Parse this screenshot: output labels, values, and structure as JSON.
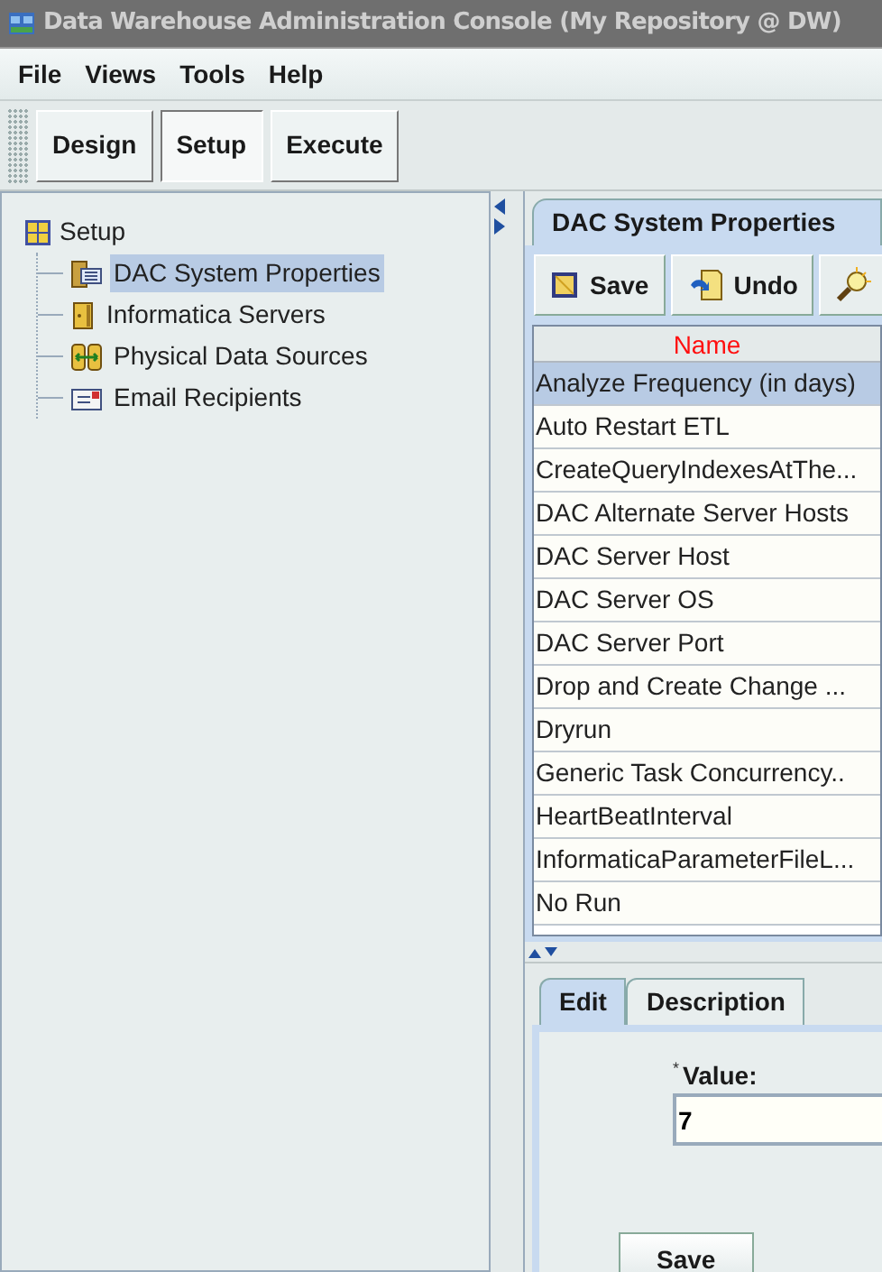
{
  "window": {
    "title": "Data Warehouse Administration Console (My Repository @ DW)"
  },
  "menu": [
    "File",
    "Views",
    "Tools",
    "Help"
  ],
  "views": [
    {
      "label": "Design",
      "selected": false
    },
    {
      "label": "Setup",
      "selected": true
    },
    {
      "label": "Execute",
      "selected": false
    }
  ],
  "tree": {
    "label": "Setup",
    "children": [
      {
        "label": "DAC System Properties",
        "kind": "properties",
        "selected": true
      },
      {
        "label": "Informatica Servers",
        "kind": "server",
        "selected": false
      },
      {
        "label": "Physical Data Sources",
        "kind": "sources",
        "selected": false
      },
      {
        "label": "Email Recipients",
        "kind": "email",
        "selected": false
      }
    ]
  },
  "panel": {
    "title": "DAC System Properties",
    "toolbar": [
      {
        "label": "Save",
        "kind": "save"
      },
      {
        "label": "Undo",
        "kind": "undo"
      },
      {
        "kind": "query"
      }
    ],
    "table": {
      "columns": [
        "Name"
      ],
      "rows": [
        {
          "name": "Analyze Frequency (in days)",
          "selected": true
        },
        {
          "name": "Auto Restart ETL",
          "selected": false
        },
        {
          "name": "CreateQueryIndexesAtThe...",
          "selected": false
        },
        {
          "name": "DAC Alternate Server Hosts",
          "selected": false
        },
        {
          "name": "DAC Server Host",
          "selected": false
        },
        {
          "name": "DAC Server OS",
          "selected": false
        },
        {
          "name": "DAC Server Port",
          "selected": false
        },
        {
          "name": "Drop and Create Change ...",
          "selected": false
        },
        {
          "name": "Dryrun",
          "selected": false
        },
        {
          "name": "Generic Task Concurrency..",
          "selected": false
        },
        {
          "name": "HeartBeatInterval",
          "selected": false
        },
        {
          "name": "InformaticaParameterFileL...",
          "selected": false
        },
        {
          "name": "No Run",
          "selected": false
        }
      ]
    }
  },
  "detail": {
    "tabs": [
      {
        "label": "Edit",
        "selected": true
      },
      {
        "label": "Description",
        "selected": false
      }
    ],
    "required_mark": "*",
    "field_label": "Value:",
    "value": "7",
    "save_button": "Save"
  }
}
